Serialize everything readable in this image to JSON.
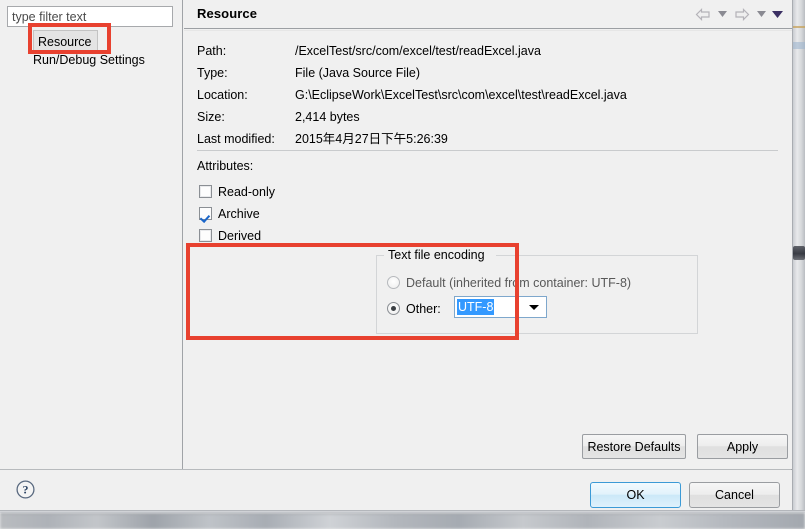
{
  "dialog": {
    "filter": {
      "placeholder": "type filter text",
      "value": ""
    },
    "tree": {
      "items": [
        {
          "label": "Resource",
          "selected": true
        },
        {
          "label": "Run/Debug Settings",
          "selected": false
        }
      ]
    },
    "page": {
      "title": "Resource",
      "nav": {
        "back_icon": "back-arrow-icon",
        "back_menu_icon": "chevron-down-icon",
        "forward_icon": "forward-arrow-icon",
        "forward_menu_icon": "chevron-down-icon",
        "menu_icon": "chevron-down-icon"
      },
      "info": [
        {
          "label": "Path:",
          "value": "/ExcelTest/src/com/excel/test/readExcel.java"
        },
        {
          "label": "Type:",
          "value": "File  (Java Source File)"
        },
        {
          "label": "Location:",
          "value": "G:\\EclipseWork\\ExcelTest\\src\\com\\excel\\test\\readExcel.java"
        },
        {
          "label": "Size:",
          "value": "2,414  bytes"
        },
        {
          "label": "Last modified:",
          "value": "2015年4月27日下午5:26:39"
        }
      ],
      "attributes": {
        "title": "Attributes:",
        "checkboxes": [
          {
            "label": "Read-only",
            "checked": false
          },
          {
            "label": "Archive",
            "checked": true
          },
          {
            "label": "Derived",
            "checked": false
          }
        ]
      },
      "encoding": {
        "legend": "Text file encoding",
        "default_option": {
          "label": "Default (inherited from container: UTF-8)",
          "selected": false
        },
        "other_option": {
          "label": "Other:",
          "selected": true
        },
        "combo": {
          "value": "UTF-8",
          "arrow_icon": "chevron-down-icon"
        }
      },
      "restore_defaults_label": "Restore Defaults",
      "apply_label": "Apply"
    },
    "footer": {
      "help_icon": "help-question-icon",
      "ok_label": "OK",
      "cancel_label": "Cancel"
    }
  },
  "annotations": {
    "accent_color": "#e8412f",
    "boxes": [
      {
        "name": "resource-tree-highlight"
      },
      {
        "name": "text-file-encoding-highlight"
      }
    ]
  }
}
